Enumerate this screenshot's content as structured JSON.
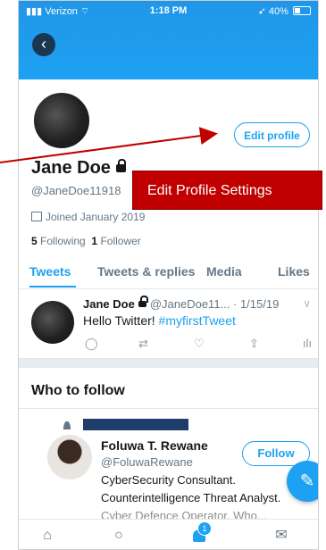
{
  "status_bar": {
    "carrier": "Verizon",
    "time": "1:18 PM",
    "battery": "40%"
  },
  "profile": {
    "name": "Jane Doe",
    "handle": "@JaneDoe11918",
    "joined": "Joined January 2019",
    "following_count": "5",
    "following_label": "Following",
    "followers_count": "1",
    "followers_label": "Follower",
    "edit_button": "Edit profile"
  },
  "callout": {
    "text": "Edit Profile Settings",
    "color": "#c00000"
  },
  "tabs": [
    "Tweets",
    "Tweets & replies",
    "Media",
    "Likes"
  ],
  "tweet": {
    "name": "Jane Doe",
    "handle": "@JaneDoe11...",
    "date": "· 1/15/19",
    "text_prefix": "Hello Twitter! ",
    "hashtag": "#myfirstTweet"
  },
  "who_to_follow": {
    "title": "Who to follow",
    "suggestion": {
      "name": "Foluwa T. Rewane",
      "handle": "@FoluwaRewane",
      "bio_line1": "CyberSecurity Consultant.",
      "bio_line2": "Counterintelligence Threat Analyst.",
      "bio_line3": "Cyber Defence Operator. Who...",
      "follow_button": "Follow"
    }
  },
  "icons": {
    "back": "back-arrow-icon",
    "reply": "reply-icon",
    "retweet": "retweet-icon",
    "like": "heart-icon",
    "share": "share-icon",
    "analytics": "analytics-icon",
    "compose": "compose-icon",
    "home": "home-icon",
    "search": "search-icon",
    "notifications": "bell-icon",
    "messages": "mail-icon"
  },
  "notifications_badge": "1",
  "colors": {
    "brand": "#1da1f2",
    "banner": "#1da1f2",
    "callout": "#c00000"
  }
}
